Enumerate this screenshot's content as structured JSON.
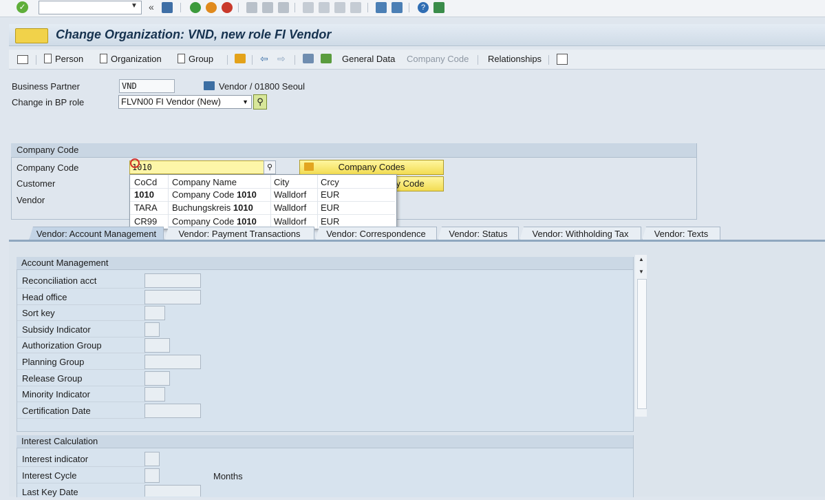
{
  "title": "Change Organization: VND, new role FI Vendor",
  "app_toolbar": {
    "person": "Person",
    "organization": "Organization",
    "group": "Group",
    "general_data": "General Data",
    "company_code": "Company Code",
    "relationships": "Relationships"
  },
  "header": {
    "bp_label": "Business Partner",
    "bp_value": "VND",
    "bp_desc": "Vendor / 01800 Seoul",
    "role_label": "Change in BP role",
    "role_value": "FLVN00 FI Vendor (New)"
  },
  "company_code_group": {
    "title": "Company Code",
    "cc_label": "Company Code",
    "cc_value": "1010",
    "customer_label": "Customer",
    "vendor_label": "Vendor",
    "btn_company_codes": "Company Codes",
    "btn_other": "ny Code"
  },
  "popup": {
    "headers": [
      "CoCd",
      "Company Name",
      "City",
      "Crcy"
    ],
    "rows": [
      {
        "cocd": "1010",
        "name_prefix": "Company Code ",
        "name_bold": "1010",
        "city": "Walldorf",
        "crcy": "EUR"
      },
      {
        "cocd": "TARA",
        "name_prefix": "Buchungskreis ",
        "name_bold": "1010",
        "city": "Walldorf",
        "crcy": "EUR"
      },
      {
        "cocd": "CR99",
        "name_prefix": "Company Code ",
        "name_bold": "1010",
        "city": "Walldorf",
        "crcy": "EUR"
      }
    ]
  },
  "tabs": [
    "Vendor: Account Management",
    "Vendor: Payment Transactions",
    "Vendor: Correspondence",
    "Vendor: Status",
    "Vendor: Withholding Tax",
    "Vendor: Texts"
  ],
  "account_management": {
    "title": "Account Management",
    "fields": [
      "Reconciliation acct",
      "Head office",
      "Sort key",
      "Subsidy Indicator",
      "Authorization Group",
      "Planning Group",
      "Release Group",
      "Minority Indicator",
      "Certification Date"
    ]
  },
  "interest": {
    "title": "Interest Calculation",
    "fields": [
      "Interest indicator",
      "Interest Cycle",
      "Last Key Date"
    ],
    "months": "Months"
  }
}
